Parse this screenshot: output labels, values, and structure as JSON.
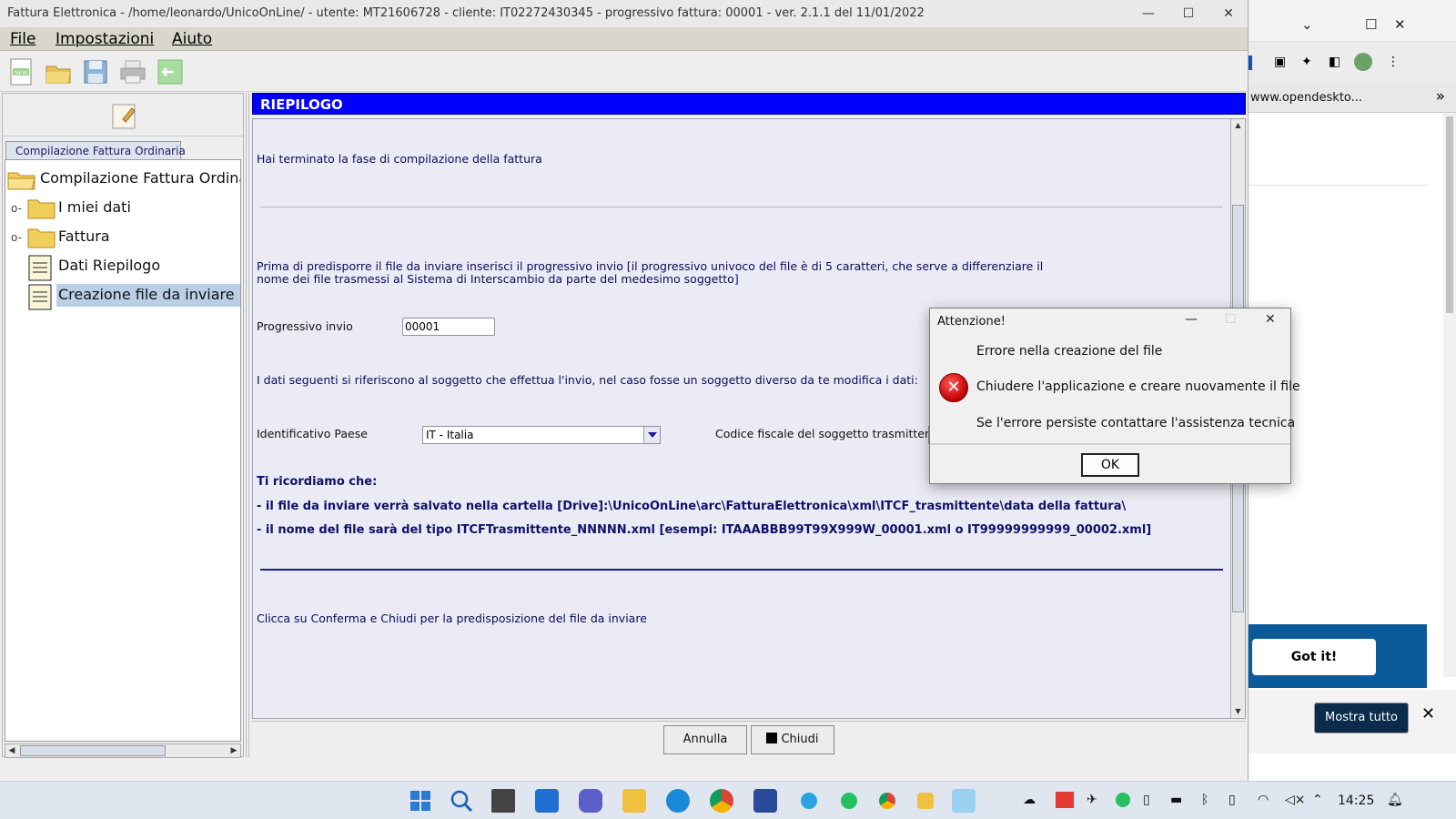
{
  "window": {
    "title": "Fattura Elettronica - /home/leonardo/UnicoOnLine/ - utente: MT21606728 - cliente: IT02272430345 - progressivo fattura: 00001 - ver. 2.1.1 del 11/01/2022",
    "minimize": "—",
    "maximize": "☐",
    "close": "✕"
  },
  "menu": {
    "file": "File",
    "impostazioni": "Impostazioni",
    "aiuto": "Aiuto"
  },
  "toolbar": {
    "icons": [
      "new-document-icon",
      "open-folder-icon",
      "save-icon",
      "print-icon",
      "exit-icon"
    ]
  },
  "sidebar": {
    "tab_label": "Compilazione Fattura Ordinaria",
    "tree": {
      "root": "Compilazione Fattura Ordinar",
      "items": [
        {
          "label": "I miei dati",
          "type": "folder"
        },
        {
          "label": "Fattura",
          "type": "folder"
        },
        {
          "label": "Dati Riepilogo",
          "type": "document"
        },
        {
          "label": "Creazione file da inviare",
          "type": "document",
          "selected": true
        }
      ]
    }
  },
  "content": {
    "header": "RIEPILOGO",
    "intro": "Hai terminato la fase di compilazione della fattura",
    "para1_line1": "Prima di predisporre il file da inviare inserisci il progressivo invio [il progressivo univoco del file è di 5 caratteri, che serve a differenziare il",
    "para1_line2": "nome dei file trasmessi al Sistema di Interscambio da parte del medesimo soggetto]",
    "progressivo_label": "Progressivo invio",
    "progressivo_value": "00001",
    "dati_soggetto": "I dati seguenti si riferiscono al soggetto che effettua l'invio, nel caso fosse un soggetto diverso da te modifica i dati:",
    "paese_label": "Identificativo Paese",
    "paese_value": "IT - Italia",
    "cf_label": "Codice fiscale del soggetto trasmittente",
    "ricorda_title": "Ti ricordiamo che:",
    "ricorda_1": "- il file da inviare verrà salvato nella cartella [Drive]:\\UnicoOnLine\\arc\\FatturaElettronica\\xml\\ITCF_trasmittente\\data della fattura\\",
    "ricorda_2": "- il nome del file sarà del tipo ITCFTrasmittente_NNNNN.xml  [esempi: ITAAABBB99T99X999W_00001.xml o IT99999999999_00002.xml]",
    "footer_text": "Clicca su Conferma e Chiudi per la predisposizione del file da inviare"
  },
  "buttons": {
    "annulla": "Annulla",
    "chiudi": "Chiudi"
  },
  "dialog": {
    "title": "Attenzione!",
    "line1": "Errore nella creazione del file",
    "line2": "Chiudere l'applicazione e creare nuovamente il file",
    "line3": "Se l'errore persiste contattare l'assistenza tecnica",
    "ok": "OK",
    "icon_glyph": "✕"
  },
  "browser": {
    "url": "www.opendeskto...",
    "more": "»",
    "chevron": "⌄",
    "got_it": "Got it!",
    "mostra_tutto": "Mostra tutto",
    "close": "✕"
  },
  "taskbar": {
    "time": "14:25",
    "apps": [
      "windows-start-icon",
      "search-icon",
      "task-view-icon",
      "widgets-icon",
      "teams-icon",
      "file-explorer-icon",
      "edge-icon",
      "chrome-icon",
      "python-icon",
      "telegram-icon",
      "whatsapp-icon",
      "chrome-small-icon",
      "folder-small-icon",
      "app-g-icon"
    ]
  },
  "colors": {
    "header_bg": "#0000ff",
    "text_blue": "#0b0b5a",
    "selection": "#b8cfe5",
    "banner": "#0b5a9a"
  }
}
